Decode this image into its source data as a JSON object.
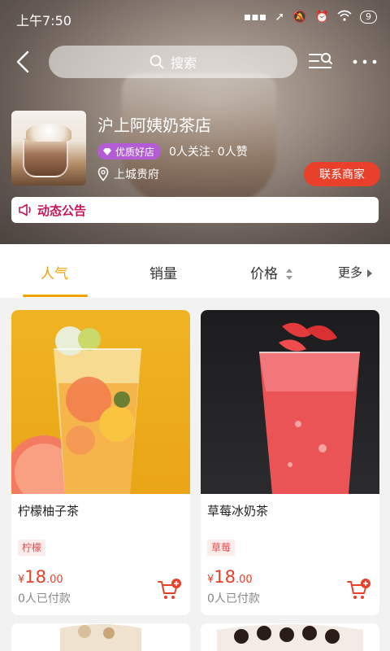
{
  "status_bar": {
    "time": "上午7:50",
    "battery": "9"
  },
  "nav": {
    "search_placeholder": "搜索"
  },
  "store": {
    "name": "沪上阿姨奶茶店",
    "badge": "优质好店",
    "follow_text": "0人关注· 0人赞",
    "location": "上城贵府",
    "contact_button": "联系商家",
    "notice": "动态公告"
  },
  "tabs": [
    {
      "label": "人气",
      "active": true
    },
    {
      "label": "销量",
      "active": false
    },
    {
      "label": "价格",
      "active": false
    },
    {
      "label": "更多",
      "active": false
    }
  ],
  "products": [
    {
      "name": "柠檬柚子茶",
      "tag": "柠檬",
      "currency": "¥",
      "price_int": "18",
      "price_dec": ".00",
      "sold": "0人已付款"
    },
    {
      "name": "草莓冰奶茶",
      "tag": "草莓",
      "currency": "¥",
      "price_int": "18",
      "price_dec": ".00",
      "sold": "0人已付款"
    }
  ],
  "colors": {
    "accent": "#f2a100",
    "price": "#e8402b",
    "notice": "#c2185b",
    "badge": "#b45bd6"
  }
}
